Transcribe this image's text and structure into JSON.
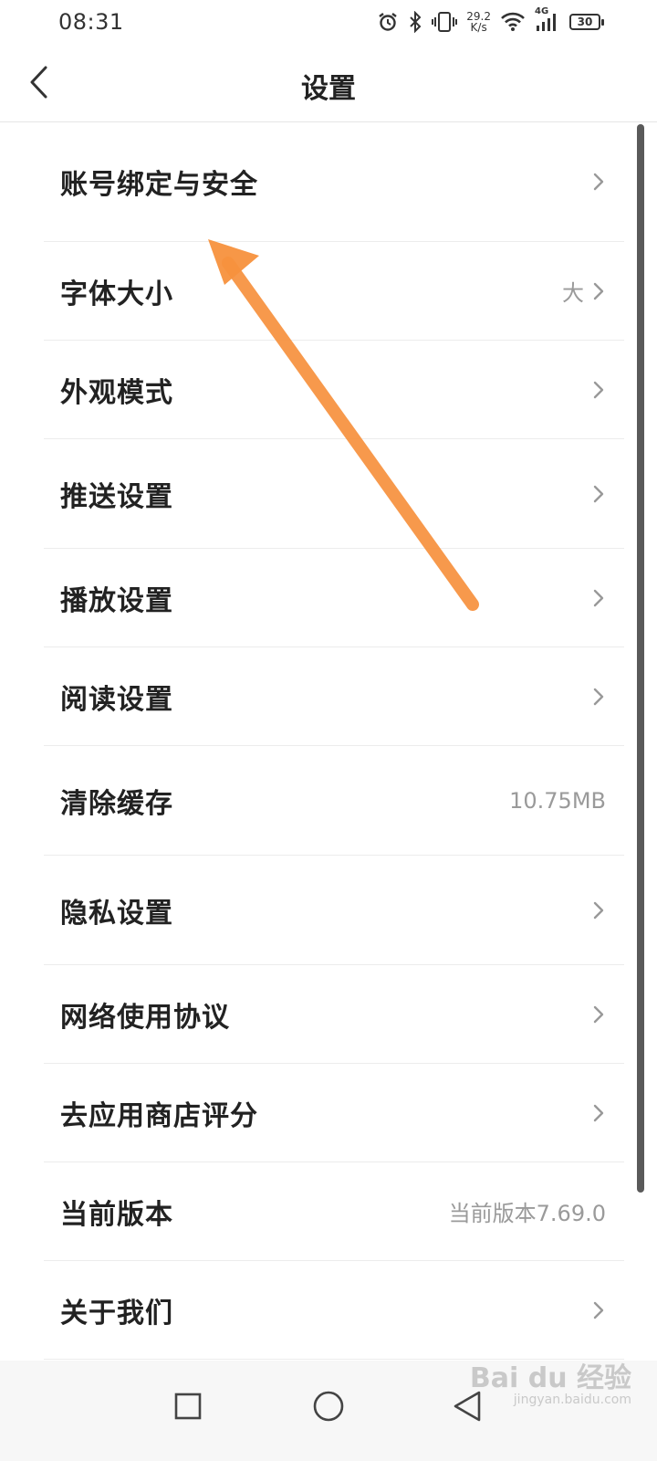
{
  "status_bar": {
    "time": "08:31",
    "net_speed_value": "29.2",
    "net_speed_unit": "K/s",
    "signal_type": "4G",
    "battery": "30",
    "icons": [
      "alarm-icon",
      "bluetooth-icon",
      "vibrate-icon",
      "wifi-icon",
      "signal-icon",
      "battery-icon"
    ]
  },
  "header": {
    "title": "设置"
  },
  "settings": {
    "items": [
      {
        "label": "账号绑定与安全",
        "value": "",
        "chevron": true
      },
      {
        "label": "字体大小",
        "value": "大",
        "chevron": true
      },
      {
        "label": "外观模式",
        "value": "",
        "chevron": true
      },
      {
        "label": "推送设置",
        "value": "",
        "chevron": true
      },
      {
        "label": "播放设置",
        "value": "",
        "chevron": true
      },
      {
        "label": "阅读设置",
        "value": "",
        "chevron": true
      },
      {
        "label": "清除缓存",
        "value": "10.75MB",
        "chevron": false
      },
      {
        "label": "隐私设置",
        "value": "",
        "chevron": true
      },
      {
        "label": "网络使用协议",
        "value": "",
        "chevron": true
      },
      {
        "label": "去应用商店评分",
        "value": "",
        "chevron": true
      },
      {
        "label": "当前版本",
        "value": "当前版本7.69.0",
        "chevron": false
      },
      {
        "label": "关于我们",
        "value": "",
        "chevron": true
      }
    ]
  },
  "watermark": {
    "brand": "Bai du 经验",
    "url": "jingyan.baidu.com"
  },
  "colors": {
    "annotation_arrow": "#f7913d",
    "divider": "#ececec",
    "value_text": "#9a9a9a"
  }
}
